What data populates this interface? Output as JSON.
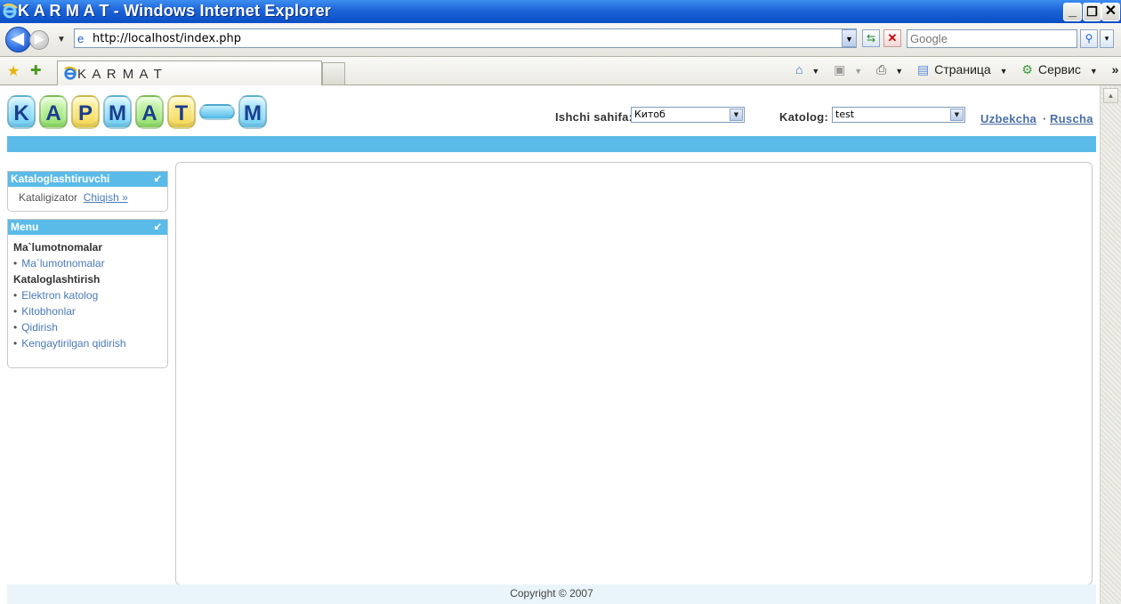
{
  "browser": {
    "title": "K A R M A T - Windows Internet Explorer",
    "url": "http://localhost/index.php",
    "search_placeholder": "Google",
    "tab_title": "K A R M A T",
    "commands": {
      "page": "Страница",
      "tools": "Сервис"
    },
    "chevron": "»"
  },
  "logo": {
    "letters": [
      "K",
      "A",
      "P",
      "M",
      "A",
      "T",
      "M"
    ]
  },
  "controls": {
    "ishchi_label": "Ishchi sahifa:",
    "ishchi_value": "Китоб",
    "katolog_label": "Katolog:",
    "katolog_value": "test",
    "lang_uz": "Uzbekcha",
    "lang_sep": "·",
    "lang_ru": "Ruscha"
  },
  "kataloglashtiruvchi_box": {
    "title": "Kataloglashtiruvchi",
    "user_text": "Kataligizator",
    "logout": "Chiqish »"
  },
  "menu_box": {
    "title": "Menu",
    "sections": [
      {
        "heading": "Ma`lumotnomalar",
        "items": [
          "Ma`lumotnomalar"
        ]
      },
      {
        "heading": "Kataloglashtirish",
        "items": [
          "Elektron katolog",
          "Kitobhonlar",
          "Qidirish",
          "Kengaytirilgan qidirish"
        ]
      }
    ]
  },
  "footer": {
    "copyright": "Copyright © 2007"
  },
  "colors": {
    "accent": "#5bbbe8",
    "link": "#4a7ab8",
    "titlebar": "#0a4ec4"
  }
}
